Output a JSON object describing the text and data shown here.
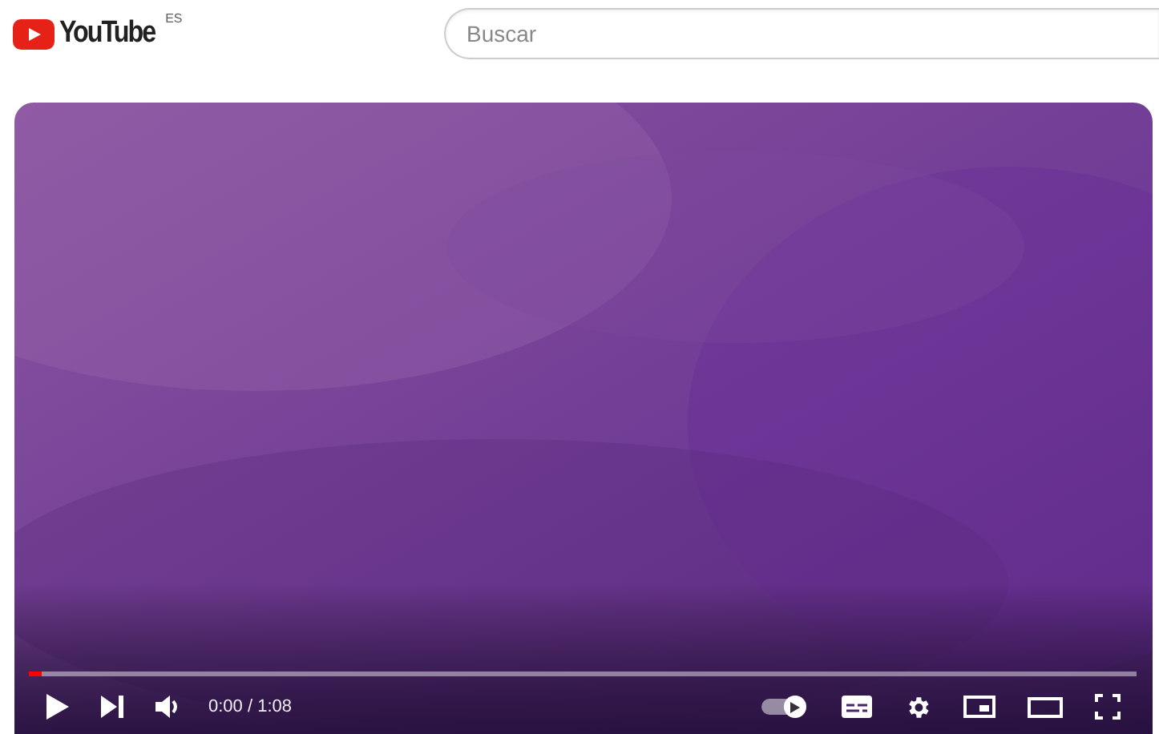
{
  "header": {
    "logo": "YouTube",
    "region": "ES",
    "search": {
      "placeholder": "Buscar"
    }
  },
  "player": {
    "kind": "picture",
    "progress": {
      "level": 0.012
    },
    "time": "0:00 / 1:08",
    "autoplay": {
      "on": true
    }
  }
}
